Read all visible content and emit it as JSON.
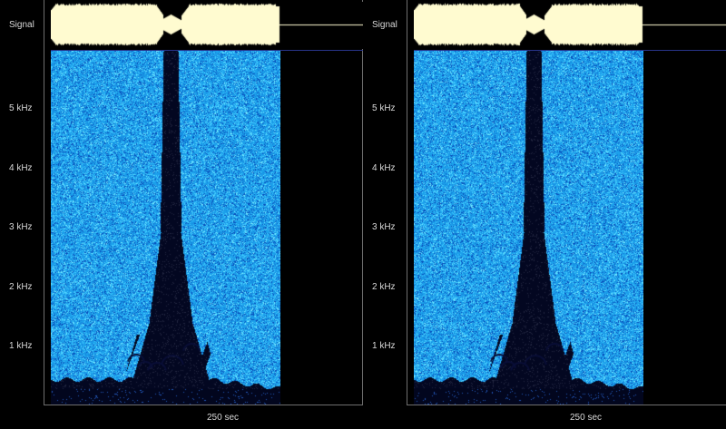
{
  "panels": [
    {
      "id": "left",
      "signal_label": "Signal",
      "freq_labels": [
        "5 kHz",
        "4 kHz",
        "3 kHz",
        "2 kHz",
        "1 kHz"
      ],
      "time_label": "250 sec"
    },
    {
      "id": "right",
      "signal_label": "Signal",
      "freq_labels": [
        "5 kHz",
        "4 kHz",
        "3 kHz",
        "2 kHz",
        "1 kHz"
      ],
      "time_label": "250 sec"
    }
  ],
  "colors": {
    "background": "#000000",
    "waveform": "#fffbd0",
    "spectrogram_base": "#1696df",
    "spectrogram_dark": "#030926",
    "spectrogram_light": "#6bdcff",
    "rule_blue": "#28348a",
    "frame_gray": "#6f6f6f",
    "label_text": "#d8d8d8"
  },
  "icons": {
    "waveform": "signal-waveform",
    "spectrogram": "frequency-spectrogram"
  }
}
